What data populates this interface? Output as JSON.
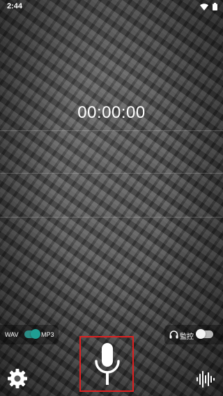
{
  "status_bar": {
    "time": "2:44",
    "icons": [
      "wifi-icon",
      "battery-icon"
    ]
  },
  "recorder": {
    "timer": "00:00:00"
  },
  "format_toggle": {
    "left_label": "WAV",
    "right_label": "MP3",
    "selected": "MP3",
    "accent_color": "#1f9e93"
  },
  "monitor_toggle": {
    "label": "監控",
    "icon": "headphones-icon",
    "enabled": false
  },
  "bottom_bar": {
    "left_icon": "settings-icon",
    "center_icon": "microphone-icon",
    "right_icon": "waveform-icon",
    "highlight_color": "#e02020"
  }
}
